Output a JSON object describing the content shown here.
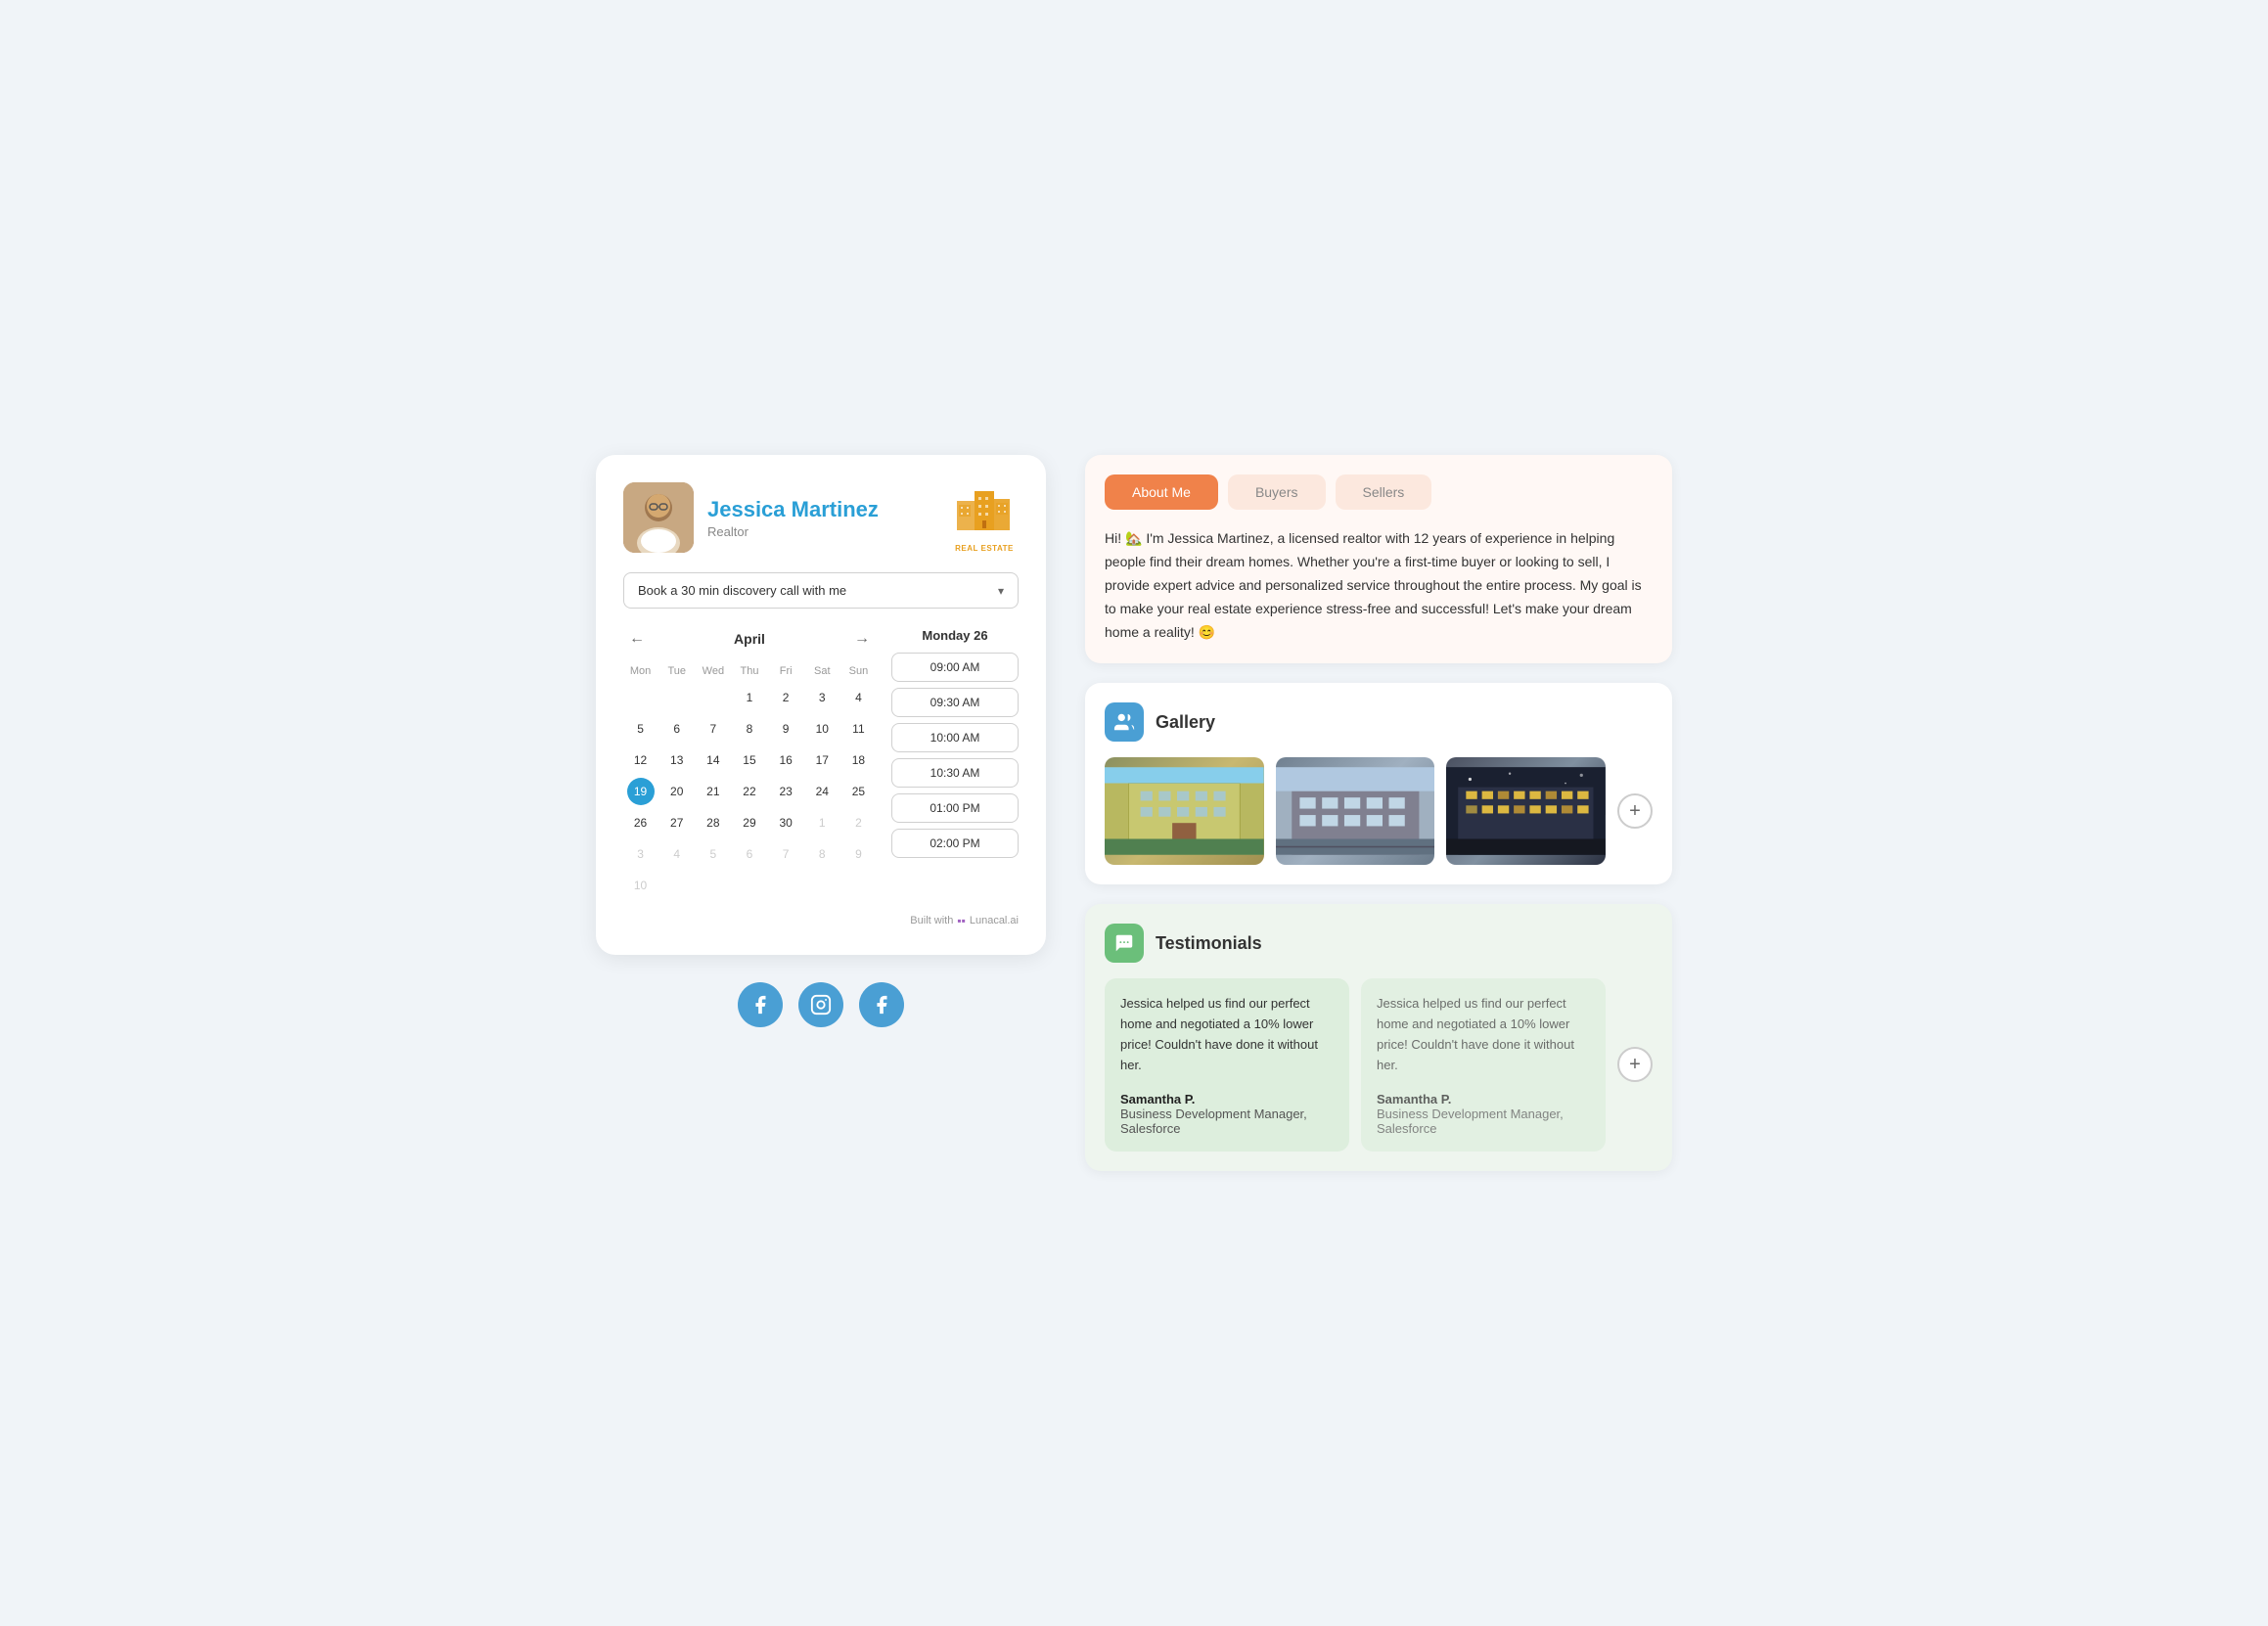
{
  "profile": {
    "name": "Jessica Martinez",
    "role": "Realtor",
    "logo_text": "REAL ESTATE",
    "booking_btn_label": "Book a 30 min discovery call with me"
  },
  "calendar": {
    "month_label": "April",
    "day_headers": [
      "Mon",
      "Tue",
      "Wed",
      "Thu",
      "Fri",
      "Sat",
      "Sun"
    ],
    "selected_day_label": "Monday 26",
    "today": 19,
    "days": [
      {
        "num": "",
        "other": false,
        "empty": true
      },
      {
        "num": "",
        "other": false,
        "empty": true
      },
      {
        "num": "",
        "other": false,
        "empty": true
      },
      {
        "num": "1",
        "other": false
      },
      {
        "num": "2",
        "other": false
      },
      {
        "num": "3",
        "other": false
      },
      {
        "num": "4",
        "other": false
      },
      {
        "num": "5",
        "other": false
      },
      {
        "num": "6",
        "other": false
      },
      {
        "num": "7",
        "other": false
      },
      {
        "num": "8",
        "other": false
      },
      {
        "num": "9",
        "other": false
      },
      {
        "num": "10",
        "other": false
      },
      {
        "num": "11",
        "other": false
      },
      {
        "num": "12",
        "other": false
      },
      {
        "num": "13",
        "other": false
      },
      {
        "num": "14",
        "other": false
      },
      {
        "num": "15",
        "other": false
      },
      {
        "num": "16",
        "other": false
      },
      {
        "num": "17",
        "other": false
      },
      {
        "num": "18",
        "other": false
      },
      {
        "num": "19",
        "today": true
      },
      {
        "num": "20",
        "other": false
      },
      {
        "num": "21",
        "other": false
      },
      {
        "num": "22",
        "other": false
      },
      {
        "num": "23",
        "other": false
      },
      {
        "num": "24",
        "other": false
      },
      {
        "num": "25",
        "other": false
      },
      {
        "num": "26",
        "other": false
      },
      {
        "num": "27",
        "other": false
      },
      {
        "num": "28",
        "other": false
      },
      {
        "num": "29",
        "other": false
      },
      {
        "num": "30",
        "other": false
      },
      {
        "num": "1",
        "other": true
      },
      {
        "num": "2",
        "other": true
      },
      {
        "num": "3",
        "other": true
      },
      {
        "num": "4",
        "other": true
      },
      {
        "num": "5",
        "other": true
      },
      {
        "num": "6",
        "other": true
      },
      {
        "num": "7",
        "other": true
      },
      {
        "num": "8",
        "other": true
      },
      {
        "num": "9",
        "other": true
      },
      {
        "num": "10",
        "other": true
      }
    ],
    "timeslots": [
      "09:00 AM",
      "09:30 AM",
      "10:00 AM",
      "10:30 AM",
      "01:00 PM",
      "02:00 PM"
    ]
  },
  "built_with": "Built with",
  "built_with_brand": "Lunacal.ai",
  "social": {
    "items": [
      "f",
      "📷",
      "f"
    ]
  },
  "tabs": {
    "items": [
      {
        "label": "About Me",
        "active": true
      },
      {
        "label": "Buyers",
        "active": false
      },
      {
        "label": "Sellers",
        "active": false
      }
    ]
  },
  "about_text": "Hi! 🏡 I'm Jessica Martinez, a licensed realtor with 12 years of experience in helping people find their dream homes. Whether you're a first-time buyer or looking to sell, I provide expert advice and personalized service throughout the entire process. My goal is to make your real estate experience stress-free and successful! Let's make your dream home a reality! 😊",
  "gallery": {
    "title": "Gallery",
    "add_label": "+"
  },
  "testimonials": {
    "title": "Testimonials",
    "items": [
      {
        "text": "Jessica helped us find our perfect home and negotiated a 10% lower price! Couldn't have done it without her.",
        "author": "Samantha P.",
        "role": "Business Development Manager, Salesforce"
      },
      {
        "text": "Jessica helped us find our perfect home and negotiated a 10% lower price! Couldn't have done it without her.",
        "author": "Samantha P.",
        "role": "Business Development Manager, Salesforce"
      }
    ],
    "add_label": "+"
  }
}
